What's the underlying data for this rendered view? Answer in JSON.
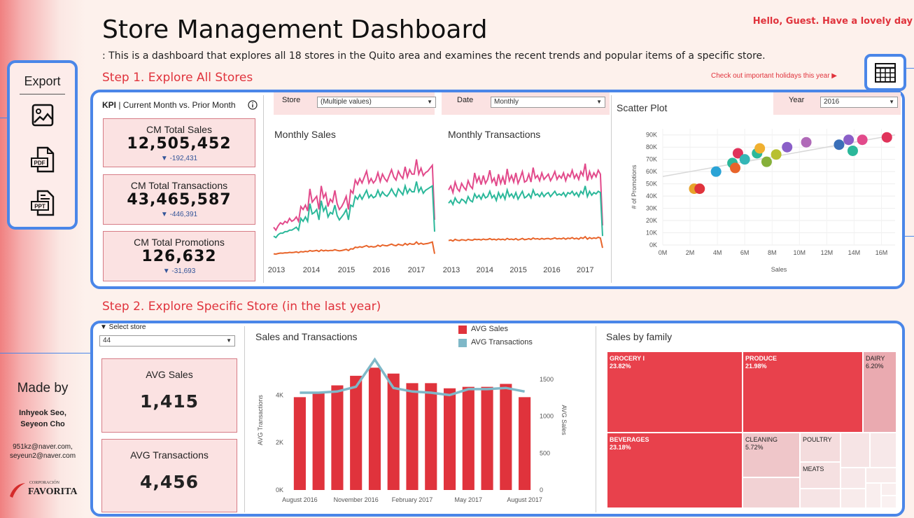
{
  "header": {
    "title": "Store Management Dashboard",
    "subtitle": ": This is a dashboard that explores all 18 stores in the Quito area and examines the recent trends and popular items of a specific store.",
    "greeting": "Hello, Guest. Have a lovely day",
    "holiday_link": "Check out important holidays this year ▶",
    "calendar_icon": "calendar-grid-icon"
  },
  "sidebar": {
    "export_title": "Export",
    "export_icons": [
      "image-export-icon",
      "pdf-export-icon",
      "ppt-export-icon"
    ],
    "made_by_title": "Made by",
    "authors": "Inhyeok Seo,",
    "authors2": "Seyeon Cho",
    "email1": "951kz@naver.com,",
    "email2": "seyeun2@naver.com",
    "logo_top": "CORPORACIÓN",
    "logo_main": "FAVORITA"
  },
  "step1": {
    "title": "Step 1. Explore All Stores",
    "kpi_header_bold": "KPI",
    "kpi_header": "| Current Month vs. Prior Month",
    "info_icon": "info-icon",
    "kpis": [
      {
        "label": "CM Total Sales",
        "value": "12,505,452",
        "delta": "▼ -192,431"
      },
      {
        "label": "CM Total Transactions",
        "value": "43,465,587",
        "delta": "▼ -446,391"
      },
      {
        "label": "CM Total Promotions",
        "value": "126,632",
        "delta": "▼ -31,693"
      }
    ],
    "store_filter": {
      "label": "Store",
      "value": "(Multiple values)"
    },
    "date_filter": {
      "label": "Date",
      "value": "Monthly"
    },
    "year_filter": {
      "label": "Year",
      "value": "2016"
    },
    "monthly_sales_title": "Monthly Sales",
    "monthly_transactions_title": "Monthly Transactions",
    "scatter_title": "Scatter Plot",
    "colors": {
      "pink": "#e24a8b",
      "teal": "#2bb89a",
      "orange": "#e8642a",
      "accent": "#e0333c",
      "frame": "#4a86e8"
    }
  },
  "step2": {
    "title": "Step 2. Explore Specific Store (in the last year)",
    "select_label": "▼ Select store",
    "select_value": "44",
    "avg_sales_label": "AVG Sales",
    "avg_sales_value": "1,415",
    "avg_trans_label": "AVG Transactions",
    "avg_trans_value": "4,456",
    "combo_title": "Sales and Transactions",
    "legend_sales": "AVG Sales",
    "legend_trans": "AVG Transactions",
    "treemap_title": "Sales by family",
    "treemap": [
      {
        "name": "GROCERY I",
        "pct": "23.82%"
      },
      {
        "name": "PRODUCE",
        "pct": "21.98%"
      },
      {
        "name": "DAIRY",
        "pct": "6.20%"
      },
      {
        "name": "BEVERAGES",
        "pct": "23.18%"
      },
      {
        "name": "CLEANING",
        "pct": "5.72%"
      },
      {
        "name": "POULTRY",
        "pct": ""
      },
      {
        "name": "MEATS",
        "pct": ""
      }
    ]
  },
  "chart_data": [
    {
      "type": "line",
      "title": "Monthly Sales",
      "x_tick_labels": [
        "2013",
        "2014",
        "2015",
        "2016",
        "2017"
      ],
      "x_range": [
        2013.0,
        2017.6
      ],
      "series": [
        {
          "color": "#e24a8b",
          "values": [
            2.2,
            2.0,
            2.3,
            2.5,
            2.4,
            2.6,
            2.5,
            2.8,
            2.6,
            2.7,
            2.9,
            2.6,
            3.6,
            3.4,
            3.7,
            3.3,
            4.8,
            3.9,
            4.1,
            4.3,
            3.4,
            5.0,
            4.2,
            4.5,
            3.6,
            4.1,
            3.9,
            4.7,
            3.8,
            3.4,
            3.6,
            3.9,
            4.3,
            3.4,
            4.7,
            4.5,
            5.4,
            5.1,
            5.5,
            5.2,
            5.6,
            6.0,
            5.2,
            5.5,
            5.2,
            5.4,
            5.9,
            5.3,
            5.8,
            5.5,
            5.3,
            5.7,
            6.1,
            5.6,
            5.4,
            6.0,
            5.7,
            5.5,
            6.3,
            5.6,
            6.1,
            5.8,
            5.8,
            6.8,
            5.8,
            6.2,
            5.7,
            5.9,
            6.0,
            6.2,
            6.4,
            2.7
          ]
        },
        {
          "color": "#2bb89a",
          "values": [
            1.6,
            1.5,
            1.7,
            1.8,
            1.8,
            1.9,
            1.9,
            2.0,
            2.0,
            2.1,
            2.2,
            2.0,
            2.8,
            2.6,
            2.9,
            2.6,
            3.8,
            3.1,
            3.2,
            3.4,
            2.7,
            4.0,
            3.3,
            3.6,
            2.9,
            3.2,
            3.1,
            3.7,
            3.0,
            2.7,
            2.9,
            3.1,
            3.4,
            2.7,
            3.7,
            3.6,
            4.3,
            4.1,
            4.4,
            4.1,
            4.4,
            4.7,
            4.2,
            4.4,
            4.2,
            4.3,
            4.7,
            4.3,
            4.6,
            4.4,
            4.3,
            4.5,
            4.8,
            4.5,
            4.3,
            4.8,
            4.6,
            4.4,
            5.0,
            4.5,
            4.8,
            4.6,
            4.6,
            5.3,
            4.6,
            4.9,
            4.5,
            4.7,
            4.8,
            4.9,
            5.0,
            1.9
          ]
        },
        {
          "color": "#e8642a",
          "values": [
            0.4,
            0.38,
            0.42,
            0.45,
            0.44,
            0.47,
            0.46,
            0.5,
            0.48,
            0.5,
            0.53,
            0.48,
            0.55,
            0.52,
            0.57,
            0.54,
            0.62,
            0.58,
            0.6,
            0.63,
            0.56,
            0.66,
            0.6,
            0.64,
            0.6,
            0.63,
            0.62,
            0.68,
            0.63,
            0.6,
            0.62,
            0.66,
            0.7,
            0.62,
            0.74,
            0.72,
            0.85,
            0.82,
            0.88,
            0.84,
            0.9,
            0.96,
            0.86,
            0.9,
            0.86,
            0.88,
            0.98,
            0.9,
            1.0,
            0.96,
            0.94,
            1.0,
            1.06,
            0.98,
            0.95,
            1.05,
            1.0,
            0.97,
            1.1,
            1.0,
            1.1,
            1.05,
            1.05,
            1.2,
            1.05,
            1.12,
            1.05,
            1.08,
            1.1,
            1.15,
            1.2,
            0.4
          ]
        }
      ]
    },
    {
      "type": "line",
      "title": "Monthly Transactions",
      "x_tick_labels": [
        "2013",
        "2014",
        "2015",
        "2016",
        "2017"
      ],
      "x_range": [
        2013.0,
        2017.6
      ],
      "series": [
        {
          "color": "#e24a8b",
          "values": [
            5.3,
            5.6,
            5.1,
            5.9,
            5.4,
            5.2,
            5.8,
            5.5,
            5.3,
            6.0,
            5.6,
            5.4,
            6.6,
            5.9,
            6.3,
            5.7,
            6.4,
            5.8,
            6.1,
            6.8,
            5.9,
            6.2,
            5.6,
            6.5,
            5.8,
            6.3,
            5.7,
            6.9,
            6.0,
            6.4,
            5.9,
            6.6,
            5.8,
            6.2,
            6.7,
            5.9,
            6.0,
            6.5,
            5.9,
            7.0,
            6.2,
            6.4,
            6.0,
            6.6,
            6.1,
            6.3,
            6.5,
            6.0,
            6.3,
            6.7,
            6.1,
            6.4,
            6.2,
            6.6,
            6.0,
            6.5,
            6.3,
            6.8,
            6.2,
            6.5,
            6.1,
            6.7,
            6.4,
            7.3,
            6.0,
            6.7,
            6.2,
            6.6,
            6.3,
            6.8,
            6.5,
            2.6
          ]
        },
        {
          "color": "#2bb89a",
          "values": [
            4.3,
            4.5,
            4.2,
            4.7,
            4.4,
            4.3,
            4.6,
            4.5,
            4.3,
            4.8,
            4.5,
            4.4,
            5.0,
            4.7,
            4.9,
            4.6,
            5.0,
            4.7,
            4.8,
            5.2,
            4.7,
            4.9,
            4.5,
            5.1,
            4.7,
            5.0,
            4.6,
            5.3,
            4.8,
            5.0,
            4.7,
            5.1,
            4.6,
            4.9,
            5.2,
            4.7,
            4.8,
            5.0,
            4.7,
            5.3,
            4.9,
            5.0,
            4.8,
            5.1,
            4.8,
            5.0,
            5.1,
            4.8,
            5.0,
            5.2,
            4.9,
            5.0,
            4.9,
            5.1,
            4.8,
            5.1,
            5.0,
            5.2,
            4.9,
            5.1,
            4.8,
            5.2,
            5.0,
            5.6,
            4.8,
            5.2,
            4.9,
            5.1,
            5.0,
            5.2,
            5.1,
            1.8
          ]
        },
        {
          "color": "#e8642a",
          "values": [
            1.45,
            1.5,
            1.42,
            1.55,
            1.48,
            1.45,
            1.52,
            1.5,
            1.46,
            1.55,
            1.5,
            1.48,
            1.56,
            1.52,
            1.55,
            1.5,
            1.57,
            1.52,
            1.54,
            1.6,
            1.52,
            1.56,
            1.5,
            1.58,
            1.52,
            1.56,
            1.5,
            1.62,
            1.54,
            1.57,
            1.52,
            1.6,
            1.5,
            1.55,
            1.62,
            1.52,
            1.55,
            1.6,
            1.54,
            1.65,
            1.57,
            1.6,
            1.55,
            1.62,
            1.56,
            1.6,
            1.62,
            1.56,
            1.6,
            1.66,
            1.58,
            1.62,
            1.58,
            1.65,
            1.56,
            1.64,
            1.6,
            1.68,
            1.58,
            1.64,
            1.56,
            1.68,
            1.62,
            1.75,
            1.56,
            1.68,
            1.6,
            1.66,
            1.62,
            1.7,
            1.65,
            0.9
          ]
        }
      ]
    },
    {
      "type": "scatter",
      "title": "Scatter Plot",
      "xlabel": "Sales",
      "ylabel": "# of Promotions",
      "x_ticks": [
        "0M",
        "2M",
        "4M",
        "6M",
        "8M",
        "10M",
        "12M",
        "14M",
        "16M"
      ],
      "y_ticks": [
        "0K",
        "10K",
        "20K",
        "30K",
        "40K",
        "50K",
        "60K",
        "70K",
        "80K",
        "90K"
      ],
      "xlim": [
        0,
        17
      ],
      "ylim": [
        0,
        95
      ],
      "points": [
        {
          "x": 2.3,
          "y": 46,
          "color": "#e8a32a"
        },
        {
          "x": 2.7,
          "y": 46,
          "color": "#e0333c"
        },
        {
          "x": 3.9,
          "y": 60,
          "color": "#2aa3d6"
        },
        {
          "x": 5.1,
          "y": 67,
          "color": "#2bb89a"
        },
        {
          "x": 5.3,
          "y": 63,
          "color": "#e8642a"
        },
        {
          "x": 5.5,
          "y": 75,
          "color": "#e0335a"
        },
        {
          "x": 6.0,
          "y": 70,
          "color": "#35b6b6"
        },
        {
          "x": 6.9,
          "y": 75,
          "color": "#2bb89a"
        },
        {
          "x": 7.1,
          "y": 79,
          "color": "#f0b030"
        },
        {
          "x": 7.6,
          "y": 68,
          "color": "#86b03a"
        },
        {
          "x": 8.3,
          "y": 74,
          "color": "#b8c030"
        },
        {
          "x": 9.1,
          "y": 80,
          "color": "#8a5fc8"
        },
        {
          "x": 10.5,
          "y": 84,
          "color": "#b06ab8"
        },
        {
          "x": 12.9,
          "y": 82,
          "color": "#3a6fb8"
        },
        {
          "x": 13.6,
          "y": 86,
          "color": "#8a5fc8"
        },
        {
          "x": 13.9,
          "y": 77,
          "color": "#2bb89a"
        },
        {
          "x": 14.6,
          "y": 86,
          "color": "#e24a8b"
        },
        {
          "x": 16.4,
          "y": 88,
          "color": "#e0335a"
        }
      ],
      "trend": [
        [
          0,
          56
        ],
        [
          17,
          90
        ]
      ]
    },
    {
      "type": "bar",
      "title": "Sales and Transactions",
      "categories": [
        "August 2016",
        "September 2016",
        "October 2016",
        "November 2016",
        "December 2016",
        "January 2017",
        "February 2017",
        "March 2017",
        "April 2017",
        "May 2017",
        "June 2017",
        "July 2017",
        "August 2017"
      ],
      "x_tick_labels": [
        "August 2016",
        "November 2016",
        "February 2017",
        "May 2017",
        "August 2017"
      ],
      "ylabel_left": "AVG Transactions",
      "ylabel_right": "AVG Sales",
      "y_ticks_left": [
        "0K",
        "2K",
        "4K"
      ],
      "y_ticks_right": [
        "0",
        "500",
        "1000",
        "1500"
      ],
      "ylim_left": [
        0,
        5900
      ],
      "ylim_right": [
        0,
        1900
      ],
      "series": [
        {
          "name": "AVG Sales",
          "type": "bar",
          "axis": "right",
          "color": "#e0333c",
          "values": [
            1260,
            1330,
            1420,
            1550,
            1660,
            1580,
            1450,
            1450,
            1380,
            1400,
            1400,
            1440,
            1260
          ]
        },
        {
          "name": "AVG Transactions",
          "type": "line",
          "axis": "left",
          "color": "#7fb8c8",
          "values": [
            4100,
            4100,
            4150,
            4350,
            5500,
            4300,
            4150,
            4100,
            4000,
            4250,
            4250,
            4300,
            4150
          ]
        }
      ]
    },
    {
      "type": "treemap",
      "title": "Sales by family",
      "items": [
        {
          "name": "GROCERY I",
          "value": 23.82
        },
        {
          "name": "PRODUCE",
          "value": 21.98
        },
        {
          "name": "DAIRY",
          "value": 6.2
        },
        {
          "name": "BEVERAGES",
          "value": 23.18
        },
        {
          "name": "CLEANING",
          "value": 5.72
        },
        {
          "name": "POULTRY"
        },
        {
          "name": "MEATS"
        }
      ]
    }
  ]
}
